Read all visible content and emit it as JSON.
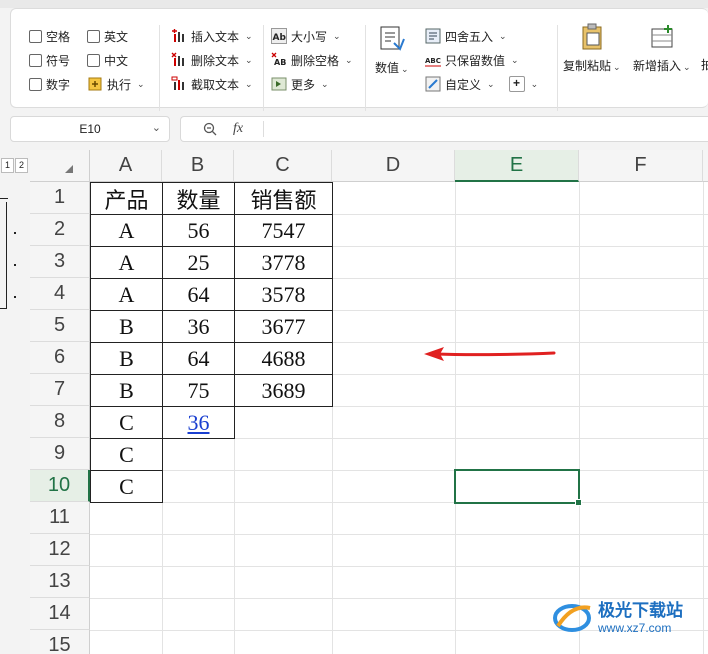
{
  "ribbon": {
    "checkboxes": [
      {
        "label": "空格"
      },
      {
        "label": "英文"
      },
      {
        "label": "符号"
      },
      {
        "label": "中文"
      },
      {
        "label": "数字"
      },
      {
        "label": "执行"
      }
    ],
    "text_group": [
      "插入文本",
      "删除文本",
      "截取文本"
    ],
    "case_group": [
      "大小写",
      "删除空格",
      "更多"
    ],
    "number_group": {
      "big": "数值",
      "items": [
        "四舍五入",
        "只保留数值",
        "自定义"
      ]
    },
    "paste_label": "复制粘贴",
    "insert_label": "新增插入",
    "truncated_label": "拍"
  },
  "formula_bar": {
    "name_box": "E10",
    "fx_label": "fx",
    "formula": ""
  },
  "outline_levels": [
    "1",
    "2"
  ],
  "columns": [
    "A",
    "B",
    "C",
    "D",
    "E",
    "F"
  ],
  "selected_column": "E",
  "rows": [
    "1",
    "2",
    "3",
    "4",
    "5",
    "6",
    "7",
    "8",
    "9",
    "10",
    "11",
    "12",
    "13",
    "14",
    "15"
  ],
  "selected_row": "10",
  "active_cell": "E10",
  "table": {
    "header": [
      "产品",
      "数量",
      "销售额"
    ],
    "rows": [
      [
        "A",
        "56",
        "7547"
      ],
      [
        "A",
        "25",
        "3778"
      ],
      [
        "A",
        "64",
        "3578"
      ],
      [
        "B",
        "36",
        "3677"
      ],
      [
        "B",
        "64",
        "4688"
      ],
      [
        "B",
        "75",
        "3689"
      ]
    ],
    "extra_a": [
      "C",
      "C",
      "C"
    ],
    "b8_link": "36"
  },
  "watermark": {
    "title": "极光下载站",
    "url": "www.xz7.com"
  },
  "colors": {
    "accent": "#217346",
    "arrow": "#e02020",
    "link": "#1a3fd0"
  }
}
